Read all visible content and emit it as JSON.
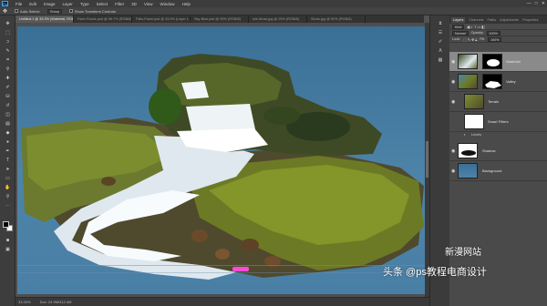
{
  "app": {
    "logo": "Ps"
  },
  "menu": [
    "File",
    "Edit",
    "Image",
    "Layer",
    "Type",
    "Select",
    "Filter",
    "3D",
    "View",
    "Window",
    "Help"
  ],
  "window_controls": [
    "—",
    "□",
    "✕"
  ],
  "options": {
    "auto_select": "Auto-Select:",
    "auto_select_target": "Group",
    "show_transform": "Show Transform Controls"
  },
  "doc_tabs": [
    {
      "label": "Untitled-1 @ 33.3% (Waterfall, RGB/8)",
      "active": true
    },
    {
      "label": "River-Rocks.psd @ 66.7% (RGB/8)",
      "active": false
    },
    {
      "label": "Falls-Panel.psd @ 33.3% (Layer 1, RGB/8)",
      "active": false
    },
    {
      "label": "Sky-Blue.psd @ 50% (RGB/8)",
      "active": false
    },
    {
      "label": "Isle-Moss.jpg @ 25% (RGB/8)",
      "active": false
    },
    {
      "label": "Stone.jpg @ 50% (RGB/8)",
      "active": false
    }
  ],
  "status": {
    "zoom": "33.33%",
    "doc": "Doc: 24.9M/312.4M"
  },
  "panel_tabs": [
    "Layers",
    "Channels",
    "Paths",
    "Adjustments",
    "Properties"
  ],
  "layer_controls": {
    "kind": "Kind",
    "blend": "Normal",
    "opacity_label": "Opacity:",
    "opacity": "100%",
    "lock_label": "Lock:",
    "fill_label": "Fill:",
    "fill": "100%"
  },
  "layers": [
    {
      "name": "Waterfall",
      "selected": true,
      "has_mask": true
    },
    {
      "name": "Valley",
      "selected": false,
      "has_mask": true
    },
    {
      "name": "Terrain",
      "selected": false,
      "has_mask": false
    },
    {
      "name": "Smart Filters",
      "selected": false,
      "has_mask": false,
      "mask_white": true
    },
    {
      "name": "Levels",
      "selected": false,
      "small": true
    },
    {
      "name": "Shadow",
      "selected": false,
      "has_mask": false
    },
    {
      "name": "Background",
      "selected": false,
      "has_mask": false
    }
  ],
  "watermark": {
    "logo_text": "新漫网站",
    "caption": "头条 @ps教程电商设计"
  },
  "colors": {
    "sky": "#4e83a8",
    "highlight": "#ff4ad8",
    "selection": "#8a8a8a"
  }
}
